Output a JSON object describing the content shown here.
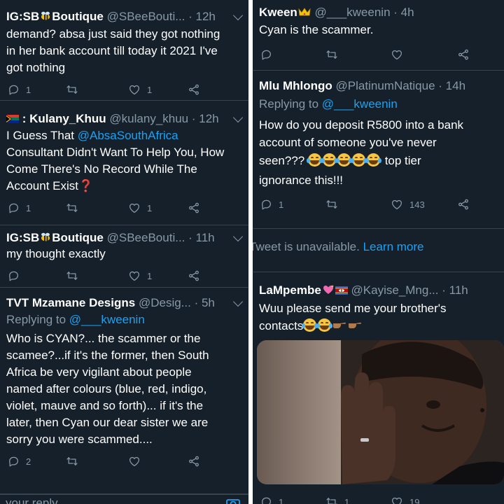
{
  "left": {
    "t1": {
      "name": "IG:SB",
      "name_suffix": "Boutique",
      "handle": "@SBeeBouti...",
      "time": "· 12h",
      "lines": [
        "demand? absa just said they got nothing",
        "in her bank account till today it 2021 I've",
        "got nothing"
      ],
      "reply_count": "1",
      "like_count": "1"
    },
    "t2": {
      "name": ": Kulany_Khuu",
      "handle": "@kulany_khuu",
      "time": "· 12h",
      "line1_prefix": "I Guess That ",
      "mention": "@AbsaSouthAfrica",
      "lines": [
        "Consultant Didn't Want To Help You, How",
        "Come There's No Record While The",
        "Account Exist"
      ],
      "question_mark": "❓",
      "reply_count": "1",
      "like_count": "1"
    },
    "t3": {
      "name": "IG:SB",
      "name_suffix": "Boutique",
      "handle": "@SBeeBouti...",
      "time": "· 11h",
      "lines": [
        "my thought exactly"
      ],
      "like_count": "1"
    },
    "t4": {
      "name": "TVT Mzamane Designs",
      "handle": "@Desig...",
      "time": "· 5h",
      "replying_label": "Replying to",
      "replying_handle": "@___kweenin",
      "lines": [
        "Who is CYAN?... the scammer or the",
        "scamee?...if it's the former, then South",
        "Africa be very vigilant about people",
        "named after colours (blue, red, indigo,",
        "violet, mauve and so forth)... if it's the",
        "later, then Cyan our dear sister we are",
        "sorry you were scammed...."
      ],
      "reply_count": "2"
    },
    "composer_placeholder": "your reply"
  },
  "right": {
    "t1": {
      "name": "Kween",
      "handle": "@___kweenin",
      "time": "· 4h",
      "lines": [
        "Cyan is the scammer."
      ]
    },
    "t2": {
      "name": "Mlu Mhlongo",
      "handle": "@PlatinumNatique",
      "time": "· 14h",
      "replying_label": "Replying to",
      "replying_handle": "@___kweenin",
      "lines": [
        "How do you deposit R5800 into a bank",
        "account of someone you've never"
      ],
      "line3_prefix": "seen???",
      "line3_suffix": "top tier",
      "line4": "ignorance this!!!",
      "reply_count": "1",
      "like_count": "143"
    },
    "unavailable": {
      "text": "Tweet is unavailable.",
      "link": "Learn more"
    },
    "t3": {
      "name": "LaMpembe",
      "handle": "@Kayise_Mng...",
      "time": "· 11h",
      "lines": [
        "Wuu please send me your brother's"
      ],
      "line2_prefix": "contacts",
      "reply_count": "1",
      "retweet_count": "1",
      "like_count": "19"
    }
  },
  "colors": {
    "background": "#15202b",
    "text": "#ffffff",
    "muted": "#8899a6",
    "link": "#1da1f2",
    "divider": "#38444d"
  }
}
